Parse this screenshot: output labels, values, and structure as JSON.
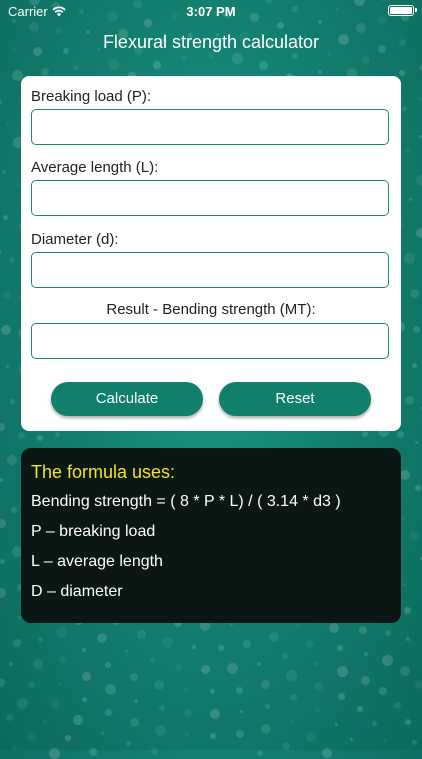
{
  "status": {
    "carrier": "Carrier",
    "time": "3:07 PM"
  },
  "app": {
    "title": "Flexural strength calculator"
  },
  "form": {
    "breaking_load_label": "Breaking load (P):",
    "breaking_load_value": "",
    "average_length_label": "Average length (L):",
    "average_length_value": "",
    "diameter_label": "Diameter (d):",
    "diameter_value": "",
    "result_label": "Result - Bending strength (MT):",
    "result_value": ""
  },
  "buttons": {
    "calculate": "Calculate",
    "reset": "Reset"
  },
  "formula": {
    "title": "The formula uses:",
    "equation": "Bending strength = ( 8 * P * L) / ( 3.14 * d3 )",
    "p_def": "P – breaking load",
    "l_def": "L – average length",
    "d_def": "D – diameter"
  },
  "colors": {
    "accent": "#10806d",
    "background": "#138070",
    "formula_title": "#f2e232",
    "formula_bg": "#0b1714"
  }
}
